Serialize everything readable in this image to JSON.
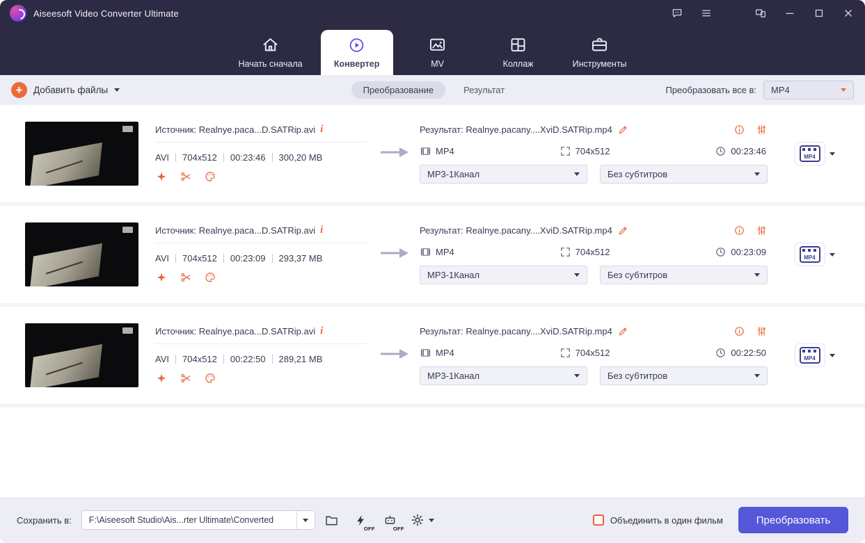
{
  "titlebar": {
    "title": "Aiseesoft Video Converter Ultimate"
  },
  "nav": {
    "tabs": [
      {
        "label": "Начать сначала"
      },
      {
        "label": "Конвертер"
      },
      {
        "label": "MV"
      },
      {
        "label": "Коллаж"
      },
      {
        "label": "Инструменты"
      }
    ]
  },
  "toolbar": {
    "add_files": "Добавить файлы",
    "segment_convert": "Преобразование",
    "segment_result": "Результат",
    "convert_all_label": "Преобразовать все в:",
    "convert_all_value": "MP4"
  },
  "files": [
    {
      "source": "Источник: Realnye.paca...D.SATRip.avi",
      "meta_format": "AVI",
      "meta_resolution": "704x512",
      "meta_duration": "00:23:46",
      "meta_size": "300,20 MB",
      "result": "Результат: Realnye.pacany....XviD.SATRip.mp4",
      "out_format": "MP4",
      "out_resolution": "704x512",
      "out_duration": "00:23:46",
      "audio": "MP3-1Канал",
      "subtitles": "Без субтитров",
      "profile_badge": "MP4"
    },
    {
      "source": "Источник: Realnye.paca...D.SATRip.avi",
      "meta_format": "AVI",
      "meta_resolution": "704x512",
      "meta_duration": "00:23:09",
      "meta_size": "293,37 MB",
      "result": "Результат: Realnye.pacany....XviD.SATRip.mp4",
      "out_format": "MP4",
      "out_resolution": "704x512",
      "out_duration": "00:23:09",
      "audio": "MP3-1Канал",
      "subtitles": "Без субтитров",
      "profile_badge": "MP4"
    },
    {
      "source": "Источник: Realnye.paca...D.SATRip.avi",
      "meta_format": "AVI",
      "meta_resolution": "704x512",
      "meta_duration": "00:22:50",
      "meta_size": "289,21 MB",
      "result": "Результат: Realnye.pacany....XviD.SATRip.mp4",
      "out_format": "MP4",
      "out_resolution": "704x512",
      "out_duration": "00:22:50",
      "audio": "MP3-1Канал",
      "subtitles": "Без субтитров",
      "profile_badge": "MP4"
    }
  ],
  "footer": {
    "save_label": "Сохранить в:",
    "save_path": "F:\\Aiseesoft Studio\\Ais...rter Ultimate\\Converted",
    "merge_checkbox": "Объединить в один фильм",
    "convert_button": "Преобразовать",
    "off_badge": "OFF"
  },
  "icons": {
    "info": "i",
    "add_plus": "+"
  },
  "colors": {
    "accent_orange": "#ED6A3C",
    "accent_purple": "#5457D8",
    "titlebar_bg": "#2D2B44",
    "toolbar_bg": "#EDEDF5"
  }
}
